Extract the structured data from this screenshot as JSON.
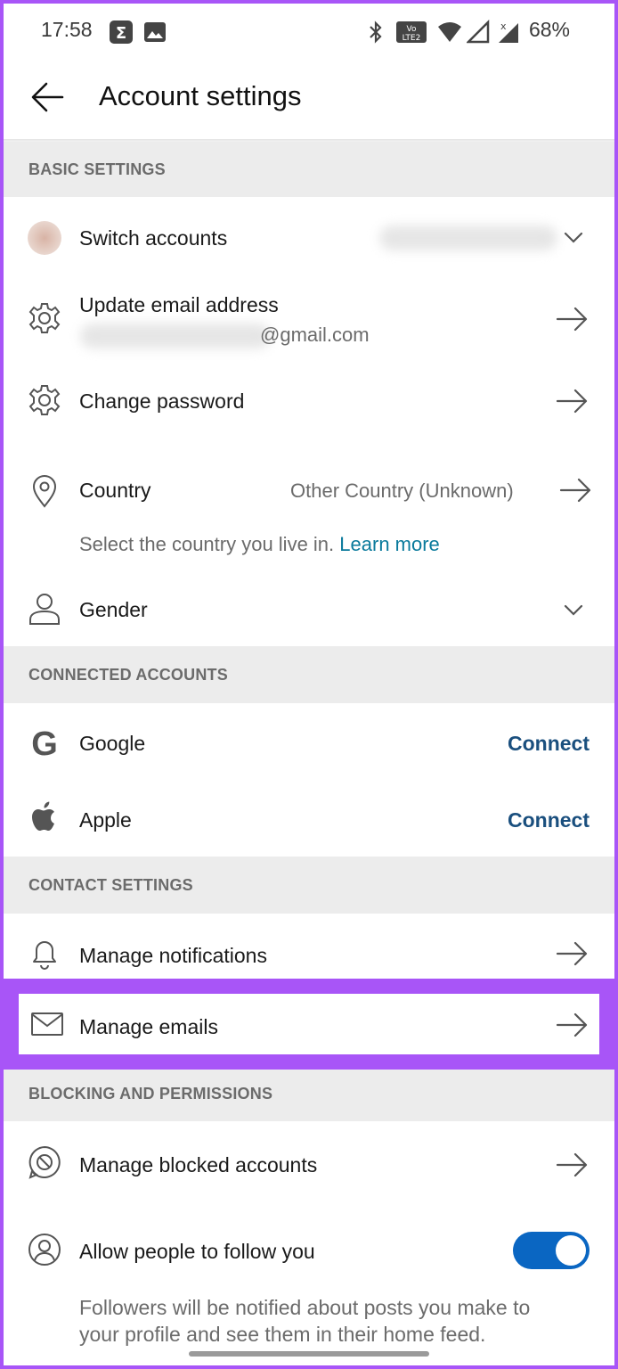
{
  "status_bar": {
    "time": "17:58",
    "battery": "68%",
    "icons": [
      "sigma-icon",
      "image-icon",
      "bluetooth-icon",
      "volte-icon",
      "wifi-icon",
      "signal-icon",
      "signal-x-icon"
    ]
  },
  "header": {
    "title": "Account settings",
    "back_icon": "arrow-left-icon"
  },
  "sections": {
    "basic": {
      "title": "BASIC SETTINGS",
      "switch_accounts": "Switch accounts",
      "update_email": "Update email address",
      "email_domain": "@gmail.com",
      "change_password": "Change password",
      "country_label": "Country",
      "country_value": "Other Country (Unknown)",
      "country_hint": "Select the country you live in.",
      "learn_more": "Learn more",
      "gender": "Gender"
    },
    "connected": {
      "title": "CONNECTED ACCOUNTS",
      "google": "Google",
      "apple": "Apple",
      "connect_label": "Connect"
    },
    "contact": {
      "title": "CONTACT SETTINGS",
      "notifications": "Manage notifications",
      "emails": "Manage emails"
    },
    "blocking": {
      "title": "BLOCKING AND PERMISSIONS",
      "blocked": "Manage blocked accounts",
      "allow_follow": "Allow people to follow you",
      "allow_follow_on": true,
      "follow_hint_line1": "Followers will be notified about posts you make to",
      "follow_hint_line2": "your profile and see them in their home feed."
    }
  },
  "colors": {
    "accent": "#0a66c2",
    "link": "#0a7a9c",
    "connect": "#1a4f7e",
    "highlight": "#a855f7"
  }
}
